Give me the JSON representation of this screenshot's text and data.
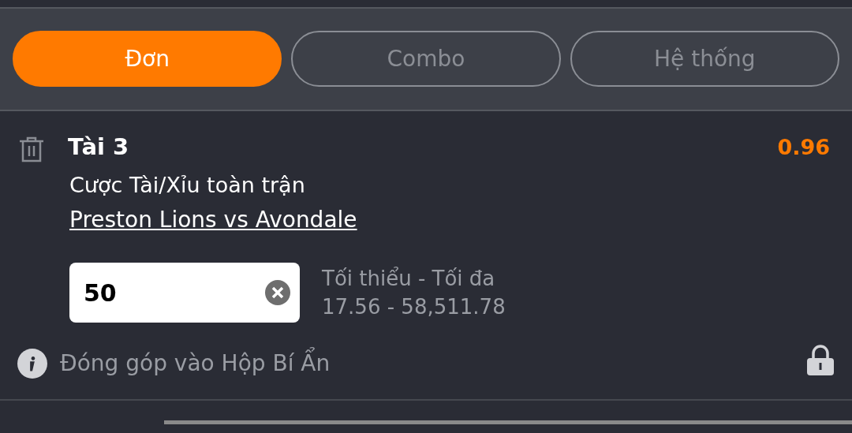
{
  "tabs": [
    {
      "label": "Đơn",
      "selected": true
    },
    {
      "label": "Combo",
      "selected": false
    },
    {
      "label": "Hệ thống",
      "selected": false
    }
  ],
  "bet": {
    "selection": "Tài 3",
    "odds": "0.96",
    "market": "Cược Tài/Xỉu toàn trận",
    "match": "Preston Lions vs Avondale",
    "stake": "50",
    "limits_label": "Tối thiểu - Tối đa",
    "limits": "17.56 - 58,511.78"
  },
  "mystery_box": {
    "label": "Đóng góp vào Hộp Bí Ẩn",
    "locked": true
  }
}
